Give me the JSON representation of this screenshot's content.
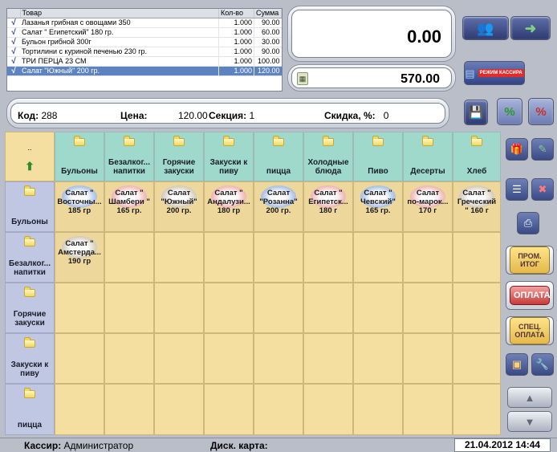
{
  "order": {
    "headers": {
      "item": "Товар",
      "qty": "Кол-во",
      "sum": "Сумма"
    },
    "rows": [
      {
        "check": "√",
        "name": "Лазанья грибная с овощами 350",
        "qty": "1.000",
        "sum": "90.00"
      },
      {
        "check": "√",
        "name": "Салат \" Египетский\" 180 гр.",
        "qty": "1.000",
        "sum": "60.00"
      },
      {
        "check": "√",
        "name": "Бульон грибной 300г",
        "qty": "1.000",
        "sum": "30.00"
      },
      {
        "check": "√",
        "name": "Тортилини с куриной печенью 230 гр.",
        "qty": "1.000",
        "sum": "90.00"
      },
      {
        "check": "√",
        "name": "ТРИ ПЕРЦА 23 СМ",
        "qty": "1.000",
        "sum": "100.00"
      },
      {
        "check": "√",
        "name": "Салат \"Южный\" 200 гр.",
        "qty": "1.000",
        "sum": "120.00"
      }
    ]
  },
  "display": {
    "current": "0.00",
    "total": "570.00",
    "calc_icon": "calculator-icon"
  },
  "info": {
    "code_label": "Код:",
    "code_value": "288",
    "price_label": "Цена:",
    "price_value": "120.00",
    "section_label": "Секция:",
    "section_value": "1",
    "discount_label": "Скидка, %:",
    "discount_value": "0"
  },
  "toolbar": {
    "mode_tag": "РЕЖИМ КАССИРА",
    "percent": "%"
  },
  "grid": {
    "corner_dots": "..",
    "top_categories": [
      "Бульоны",
      "Безалког... напитки",
      "Горячие закуски",
      "Закуски к пиву",
      "пицца",
      "Холодные блюда",
      "Пиво",
      "Десерты",
      "Хлеб"
    ],
    "side_categories": [
      "Бульоны",
      "Безалког... напитки",
      "Горячие закуски",
      "Закуски к пиву",
      "пицца"
    ],
    "products_row1": [
      {
        "l1": "Салат \"",
        "l2": "Восточны...",
        "l3": "185 гр"
      },
      {
        "l1": "Салат \"",
        "l2": "Шамбери \"",
        "l3": "165 гр."
      },
      {
        "l1": "Салат",
        "l2": "\"Южный\"",
        "l3": "200 гр."
      },
      {
        "l1": "Салат \"",
        "l2": "Андалузи...",
        "l3": "180 гр"
      },
      {
        "l1": "Салат",
        "l2": "\"Розанна\"",
        "l3": "200 гр."
      },
      {
        "l1": "Салат \"",
        "l2": "Египетск...",
        "l3": "180 г"
      },
      {
        "l1": "Салат \"",
        "l2": "Чевский\"",
        "l3": "165 гр."
      },
      {
        "l1": "Салат",
        "l2": "по-марок...",
        "l3": "170 г"
      },
      {
        "l1": "Салат \"",
        "l2": "Греческий",
        "l3": "\" 160 г"
      }
    ],
    "products_row2": [
      {
        "l1": "Салат \"",
        "l2": "Амстерда...",
        "l3": "190 гр"
      }
    ]
  },
  "right_panel": {
    "subtotal": "ПРОМ. ИТОГ",
    "pay": "ОПЛАТА",
    "special_pay": "СПЕЦ. ОПЛАТА"
  },
  "status": {
    "cashier_label": "Кассир:",
    "cashier_value": "Администратор",
    "card_label": "Диск. карта:",
    "datetime": "21.04.2012 14:44"
  }
}
